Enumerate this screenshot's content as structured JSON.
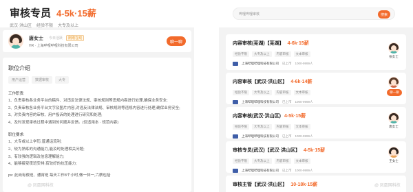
{
  "left": {
    "job_title": "审核专员",
    "salary": "4-5k·15薪",
    "tags": [
      "武汉·洪山区",
      "经验不限",
      "大专及以上"
    ],
    "recruiter": {
      "name": "唐女士",
      "active": "· 今日活跃",
      "badge": "刚刚在线",
      "company": "HR · 上海哔哩哔哩科技有限公司",
      "chat_label": "聊一聊"
    },
    "desc_title": "职位介绍",
    "chips": [
      "用户运营",
      "数据审核",
      "大专"
    ],
    "duties_heading": "工作职责:",
    "duties": [
      "1、负责审核各业务平台的稿件、对违反法律法规、审核规则等违规内容进行处理,确保业务安全;",
      "2、负责审核各业务平台文字及图片内容,对违反法律法规、审核规则等违规内容进行处理,确保业务安全;",
      "3、对负责内容的审核、用户投诉的处理进行研究和处理;",
      "4、及时发现审核过程中遇到的问题并反馈。(仅适用本 · 规范内容)"
    ],
    "req_heading": "职位要求:",
    "requirements": [
      "1、大专或以上学历,普通话流利;",
      "2、较为熟练的沟通能力,能及时处理相关问题;",
      "3、有较强的逻辑及信息理解能力;",
      "4、能够接受夜班安排,有较好的抗压能力;"
    ],
    "footer_note": "ps: 此岗有夜班、通宵班 每天工作8个小时,做一休一,六薪包括",
    "watermark": "@ 凤凰网科技"
  },
  "right": {
    "search_placeholder": "哔哩哔哩审核",
    "search_button": "搜索",
    "cards": [
      {
        "title": "内容审核(芜湖)【芜湖】",
        "salary": "4-6k·15薪",
        "tags": [
          "经验不限",
          "大专及以上",
          "内容审核",
          "文本审核"
        ],
        "company": "上海哔哩哔哩科技有限公司",
        "meta": [
          "已上市",
          "1000-9999人"
        ],
        "recruiter": "张女士",
        "chat": ""
      },
      {
        "title": "内容审核【武汉·洪山区】",
        "salary": "4-6k·14薪",
        "tags": [
          "经验不限",
          "大专及以上",
          "内容审核",
          "文本审核"
        ],
        "company": "上海哔哩哔哩科技有限公司",
        "meta": [
          "已上市",
          "1000-9999人"
        ],
        "recruiter": "",
        "chat": "聊一聊"
      },
      {
        "title": "内容审核(武汉·洪山区)",
        "salary": "4-5k·15薪",
        "tags": [
          "经验不限",
          "大专及以上",
          "内容审核",
          "文本审核"
        ],
        "company": "上海哔哩哔哩科技有限公司",
        "meta": [
          "已上市",
          "1000-9999人"
        ],
        "recruiter": "唐女士",
        "chat": ""
      },
      {
        "title": "审核专员(武汉)【武汉·洪山区】",
        "salary": "4-5k·15薪",
        "tags": [
          "经验不限",
          "大专及以上",
          "内容审核",
          "文本审核"
        ],
        "company": "上海哔哩哔哩科技有限公司",
        "meta": [
          "已上市",
          "1000-9999人"
        ],
        "recruiter": "王女士",
        "chat": ""
      },
      {
        "title": "审核主管【武汉·洪山区】",
        "salary": "10-18k·15薪",
        "tags": [],
        "company": "",
        "meta": [],
        "recruiter": "",
        "chat": ""
      }
    ],
    "watermark": "@ 凤凰网科技"
  }
}
